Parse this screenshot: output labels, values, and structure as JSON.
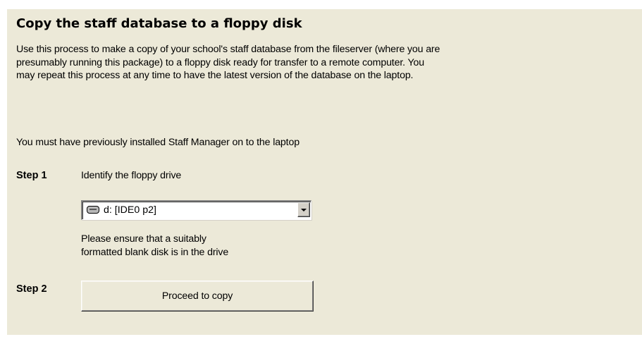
{
  "title": "Copy the staff database to a floppy disk",
  "intro_lines": [
    "Use this process to make a copy of your school's staff database from the fileserver (where you are",
    "presumably running this package) to a floppy disk ready for transfer to a remote computer.  You",
    "may repeat this process at any time to have the latest version of the database on the laptop."
  ],
  "prerequisite": "You must have previously installed Staff Manager on to the laptop",
  "step1": {
    "label": "Step 1",
    "instruction": "Identify the floppy drive",
    "drive_select": {
      "value": "d: [IDE0 p2]",
      "icon": "drive-icon"
    },
    "hint_lines": [
      "Please ensure that a suitably",
      "formatted blank disk is in the drive"
    ]
  },
  "step2": {
    "label": "Step 2",
    "button_label": "Proceed to copy"
  },
  "colors": {
    "panel_background": "#ece9d8"
  }
}
